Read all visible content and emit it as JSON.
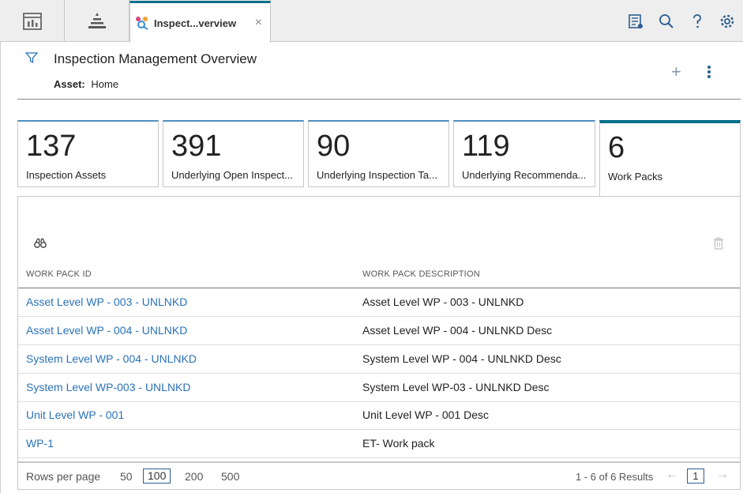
{
  "tabs": {
    "active_title": "Inspect...verview",
    "close_glyph": "×"
  },
  "header": {
    "title": "Inspection Management Overview",
    "asset_label": "Asset:",
    "asset_value": "Home",
    "add_glyph": "+"
  },
  "tiles": [
    {
      "value": "137",
      "label": "Inspection Assets"
    },
    {
      "value": "391",
      "label": "Underlying Open Inspect..."
    },
    {
      "value": "90",
      "label": "Underlying Inspection Ta..."
    },
    {
      "value": "119",
      "label": "Underlying Recommenda..."
    },
    {
      "value": "6",
      "label": "Work Packs"
    }
  ],
  "table": {
    "columns": [
      "WORK PACK ID",
      "WORK PACK DESCRIPTION"
    ],
    "rows": [
      {
        "id": "Asset Level WP - 003 - UNLNKD",
        "desc": "Asset Level WP - 003 - UNLNKD"
      },
      {
        "id": "Asset Level WP - 004 - UNLNKD",
        "desc": "Asset Level WP - 004 - UNLNKD Desc"
      },
      {
        "id": "System Level WP - 004 - UNLNKD",
        "desc": "System Level WP - 004 - UNLNKD Desc"
      },
      {
        "id": "System Level WP-003 - UNLNKD",
        "desc": "System Level WP-03 - UNLNKD Desc"
      },
      {
        "id": "Unit Level WP - 001",
        "desc": "Unit Level WP - 001 Desc"
      },
      {
        "id": "WP-1",
        "desc": "ET- Work pack"
      }
    ]
  },
  "footer": {
    "rows_per_page_label": "Rows per page",
    "options": [
      "50",
      "100",
      "200",
      "500"
    ],
    "selected_option": "100",
    "results": "1 - 6 of 6 Results",
    "page": "1",
    "prev_glyph": "←",
    "next_glyph": "→"
  },
  "colors": {
    "accent": "#00708a",
    "link": "#2a72b8"
  }
}
